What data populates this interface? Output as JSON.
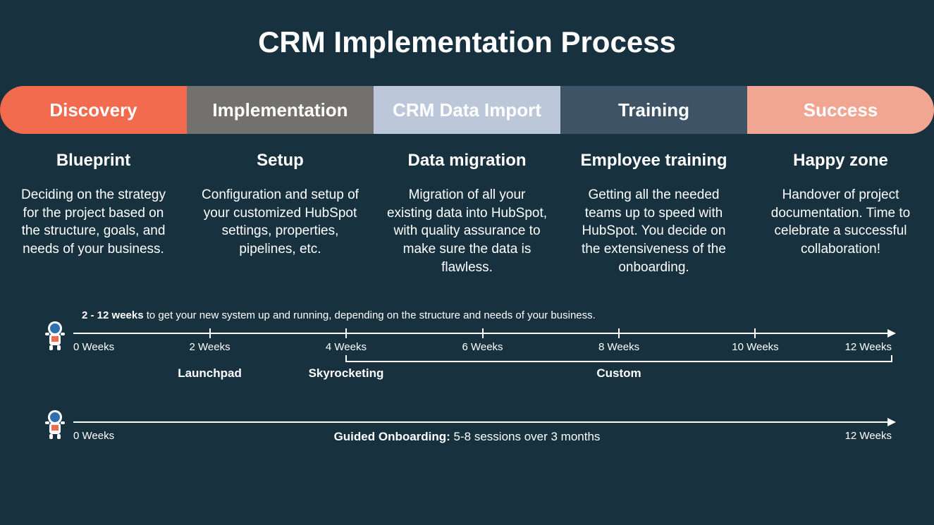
{
  "title": "CRM Implementation Process",
  "stages": [
    {
      "label": "Discovery",
      "bg": "#f36b4f",
      "fg": "#ffffff"
    },
    {
      "label": "Implementation",
      "bg": "#72716f",
      "fg": "#ffffff"
    },
    {
      "label": "CRM Data Import",
      "bg": "#bcc8da",
      "fg": "#ffffff"
    },
    {
      "label": "Training",
      "bg": "#3e5466",
      "fg": "#ffffff"
    },
    {
      "label": "Success",
      "bg": "#f1a693",
      "fg": "#ffffff"
    }
  ],
  "details": [
    {
      "title": "Blueprint",
      "desc": "Deciding on the strategy for the project based on the structure, goals, and needs of your business."
    },
    {
      "title": "Setup",
      "desc": "Configuration and setup of your customized HubSpot settings, properties, pipelines, etc."
    },
    {
      "title": "Data migration",
      "desc": "Migration of all your existing data into HubSpot, with quality assurance to make sure the data is flawless."
    },
    {
      "title": "Employee training",
      "desc": "Getting all the needed teams up to speed with HubSpot. You decide on the extensiveness of the onboarding."
    },
    {
      "title": "Happy zone",
      "desc": "Handover of project documentation. Time to celebrate a successful collaboration!"
    }
  ],
  "timeline_note_bold": "2 - 12 weeks",
  "timeline_note_rest": " to get your new system up and running, depending on the structure and needs of your business.",
  "ticks": [
    {
      "label": "0 Weeks",
      "pct": 0,
      "show_tick": false
    },
    {
      "label": "2 Weeks",
      "pct": 16.67,
      "show_tick": true
    },
    {
      "label": "4 Weeks",
      "pct": 33.33,
      "show_tick": true
    },
    {
      "label": "6 Weeks",
      "pct": 50.0,
      "show_tick": true
    },
    {
      "label": "8 Weeks",
      "pct": 66.67,
      "show_tick": true
    },
    {
      "label": "10 Weeks",
      "pct": 83.33,
      "show_tick": true
    },
    {
      "label": "12 Weeks",
      "pct": 100.0,
      "show_tick": false
    }
  ],
  "phases": [
    {
      "label": "Launchpad",
      "center_pct": 16.67
    },
    {
      "label": "Skyrocketing",
      "center_pct": 33.33
    },
    {
      "label": "Custom",
      "center_pct": 66.67
    }
  ],
  "bracket": {
    "from_pct": 33.33,
    "to_pct": 100.0
  },
  "timeline2": {
    "start_label": "0 Weeks",
    "end_label": "12 Weeks",
    "guided_bold": "Guided Onboarding:",
    "guided_rest": " 5-8 sessions over 3 months"
  }
}
